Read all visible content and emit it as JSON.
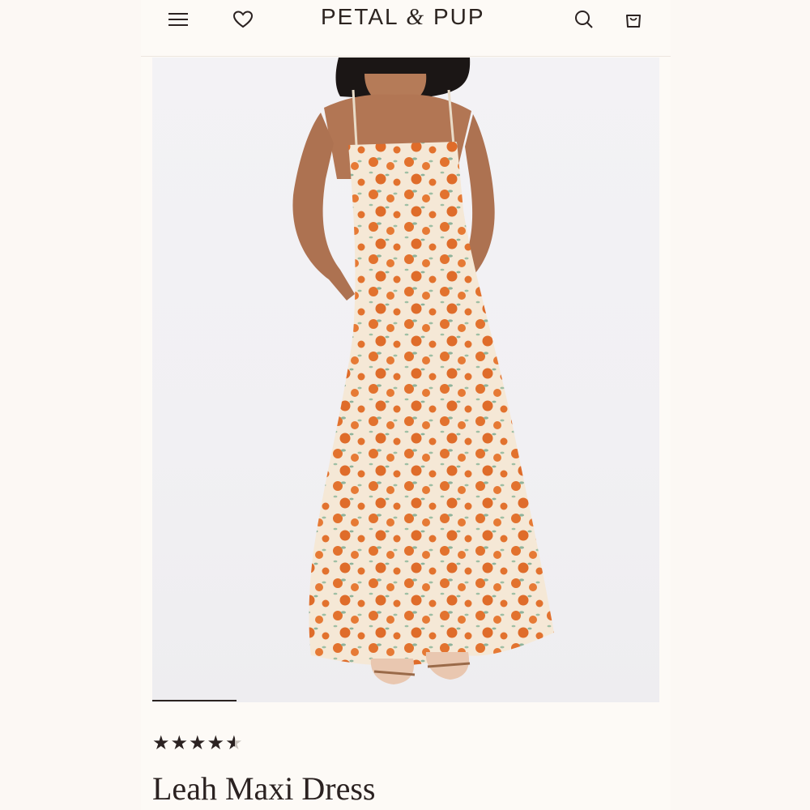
{
  "header": {
    "brand": "PETAL",
    "brand_amp": "&",
    "brand_end": "PUP",
    "menu_icon": "hamburger-menu-icon",
    "wishlist_icon": "heart-icon",
    "search_icon": "search-icon",
    "cart_icon": "shopping-bag-icon"
  },
  "product": {
    "image": "model-wearing-orange-print-maxi-dress",
    "rating_value": 4.5,
    "rating_max": 5,
    "stars": [
      "★",
      "★",
      "★",
      "★",
      "★"
    ],
    "title": "Leah Maxi Dress"
  },
  "colors": {
    "dress_base": "#f5e8d6",
    "orange_print": "#e2722e",
    "leaf_print": "#8fb39a",
    "text": "#2b2221"
  }
}
